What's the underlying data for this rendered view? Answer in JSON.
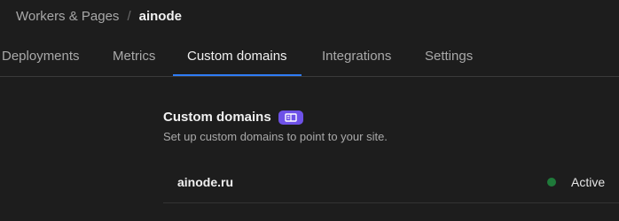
{
  "breadcrumb": {
    "parent": "Workers & Pages",
    "separator": "/",
    "current": "ainode"
  },
  "tabs": [
    {
      "label": "Deployments",
      "active": false
    },
    {
      "label": "Metrics",
      "active": false
    },
    {
      "label": "Custom domains",
      "active": true
    },
    {
      "label": "Integrations",
      "active": false
    },
    {
      "label": "Settings",
      "active": false
    }
  ],
  "section": {
    "title": "Custom domains",
    "badge_icon": "book-icon",
    "subtitle": "Set up custom domains to point to your site."
  },
  "domains": [
    {
      "name": "ainode.ru",
      "status": "Active",
      "status_color": "#1f7a3a"
    }
  ],
  "colors": {
    "background": "#1d1d1d",
    "accent": "#2f7cf6",
    "badge": "#6e52e8"
  }
}
